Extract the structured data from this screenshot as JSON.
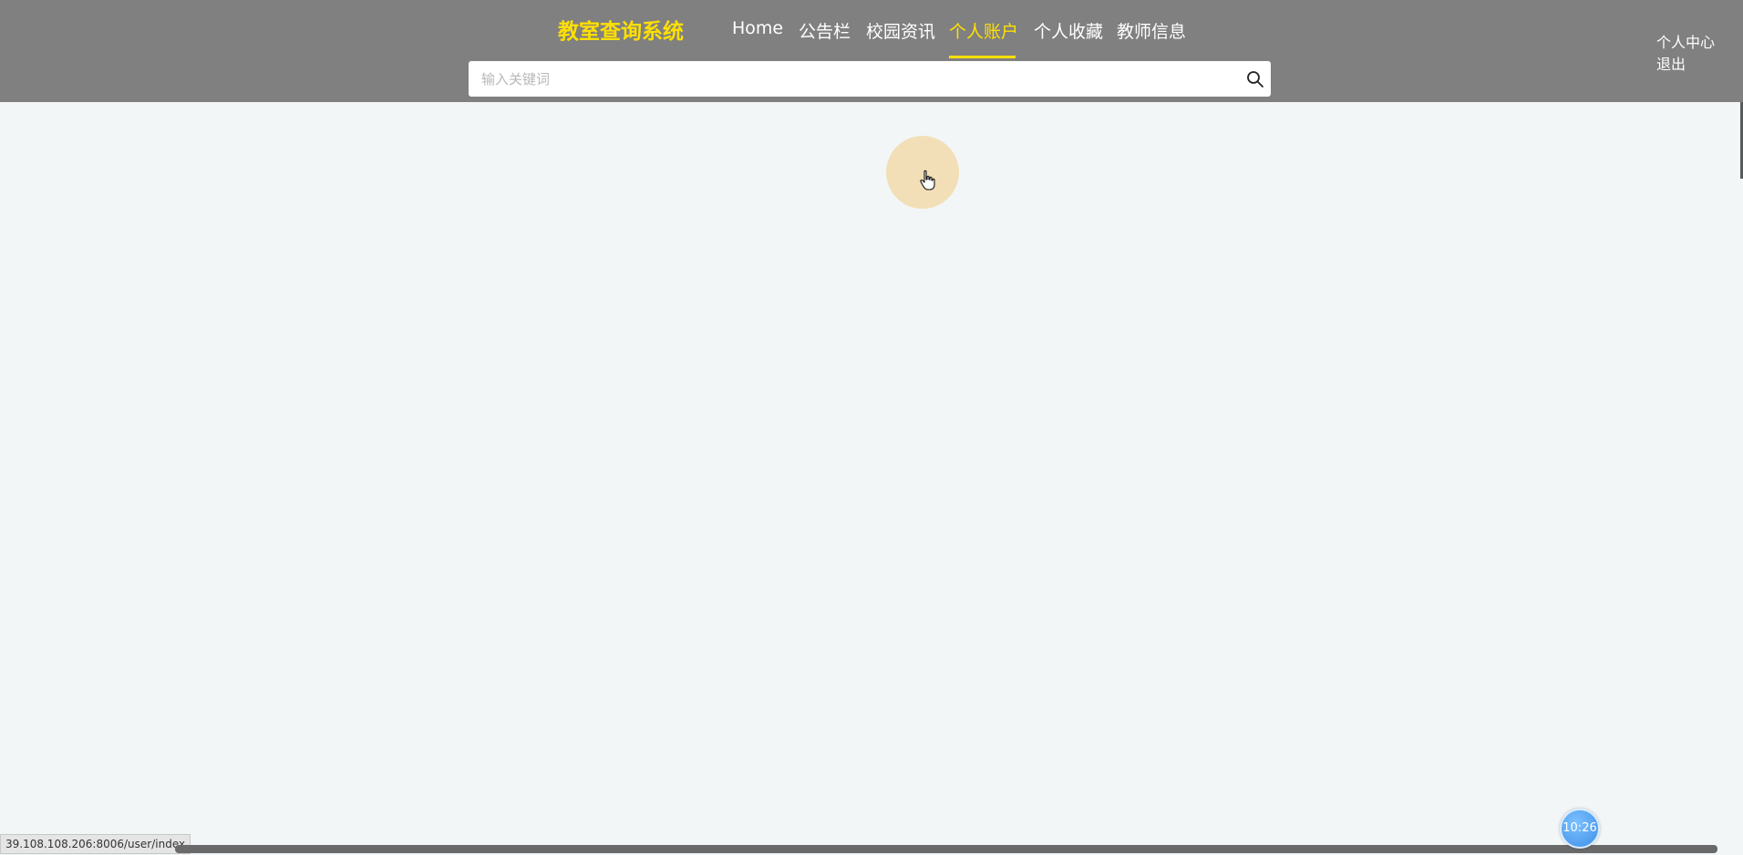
{
  "header": {
    "brand": "教室查询系统",
    "nav": [
      {
        "label": "Home"
      },
      {
        "label": "公告栏"
      },
      {
        "label": "校园资讯"
      },
      {
        "label": "个人账户",
        "active": true
      },
      {
        "label": "个人收藏"
      },
      {
        "label": "教师信息"
      }
    ],
    "search": {
      "placeholder": "输入关键词",
      "value": "",
      "icon": "search-icon"
    },
    "user_menu": {
      "profile_label": "个人中心",
      "logout_label": "退出"
    }
  },
  "status_bar": {
    "url": "39.108.108.206:8006/user/index"
  },
  "clock": {
    "time": "10:26"
  },
  "colors": {
    "header_bg": "#808080",
    "accent": "#ffe000",
    "page_bg": "#f3f6f7",
    "loader": "#f3dfb7"
  }
}
